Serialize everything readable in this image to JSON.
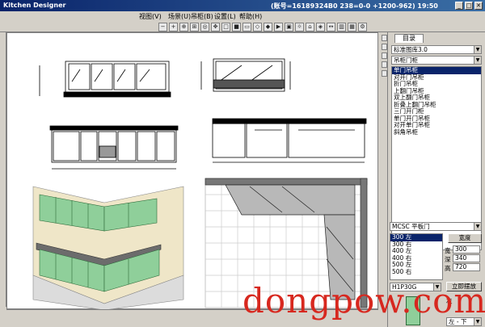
{
  "window": {
    "title": "Kitchen Designer",
    "status_text": "(账号=16189324B0 238=0-0 +1200-962) 19:50",
    "min_glyph": "_",
    "max_glyph": "□",
    "close_glyph": "✕"
  },
  "menu": [
    {
      "label": "视图(V)"
    },
    {
      "label": "场景(U)"
    },
    {
      "label": "吊柜(B)"
    },
    {
      "label": "设置(L)"
    },
    {
      "label": "帮助(H)"
    }
  ],
  "toolbar": {
    "buttons": [
      "zoom-out-icon",
      "zoom-in-icon",
      "zoom-window-icon",
      "zoom-all-icon",
      "camera-icon",
      "pan-icon",
      "front-view-icon",
      "top-view-icon",
      "side-view-icon",
      "iso-view-icon",
      "render-icon",
      "play-icon",
      "cabinet-icon",
      "light-icon",
      "door-icon",
      "handle-icon",
      "dimension-icon",
      "wall-icon",
      "window-icon",
      "settings-icon"
    ],
    "glyphs": [
      "−",
      "+",
      "⊕",
      "⊞",
      "◎",
      "✥",
      "□",
      "■",
      "▭",
      "◇",
      "◆",
      "▶",
      "▣",
      "☼",
      "⌂",
      "◈",
      "↔",
      "▥",
      "▦",
      "⚙"
    ]
  },
  "right_panel": {
    "tab_label": "目录",
    "library_combo": "标准图库3.0",
    "category_combo": "吊柜门柜",
    "items": [
      "单门吊柜",
      "对开门吊柜",
      "折门吊柜",
      "上翻门吊柜",
      "双上翻门吊柜",
      "折叠上翻门吊柜",
      "三门开门柜",
      "单门开门吊柜",
      "对开单门吊柜",
      "斜角吊柜"
    ],
    "selected_item": "单门吊柜",
    "model_combo": "MCSC 平板门",
    "size_items": [
      "300 左",
      "300 右",
      "400 左",
      "400 右",
      "500 左",
      "500 右"
    ],
    "selected_size": "300 左",
    "width_button": "宽度",
    "width_label": "宽",
    "width_value": "300",
    "depth_label": "深",
    "depth_value": "340",
    "height_label": "高",
    "height_value": "720",
    "handle_combo": "H1P30G",
    "place_button": "立即摆放",
    "opening_label": "左",
    "position_combo": "左 - 下"
  },
  "watermark": "dongpow.com",
  "colors": {
    "title_gradient_start": "#0a246a",
    "title_gradient_end": "#3a6ea5",
    "cabinet_green": "#8fcf9a",
    "wall_beige": "#efe6c8",
    "counter_gray": "#6c6c6c",
    "watermark_red": "#d7281f"
  }
}
